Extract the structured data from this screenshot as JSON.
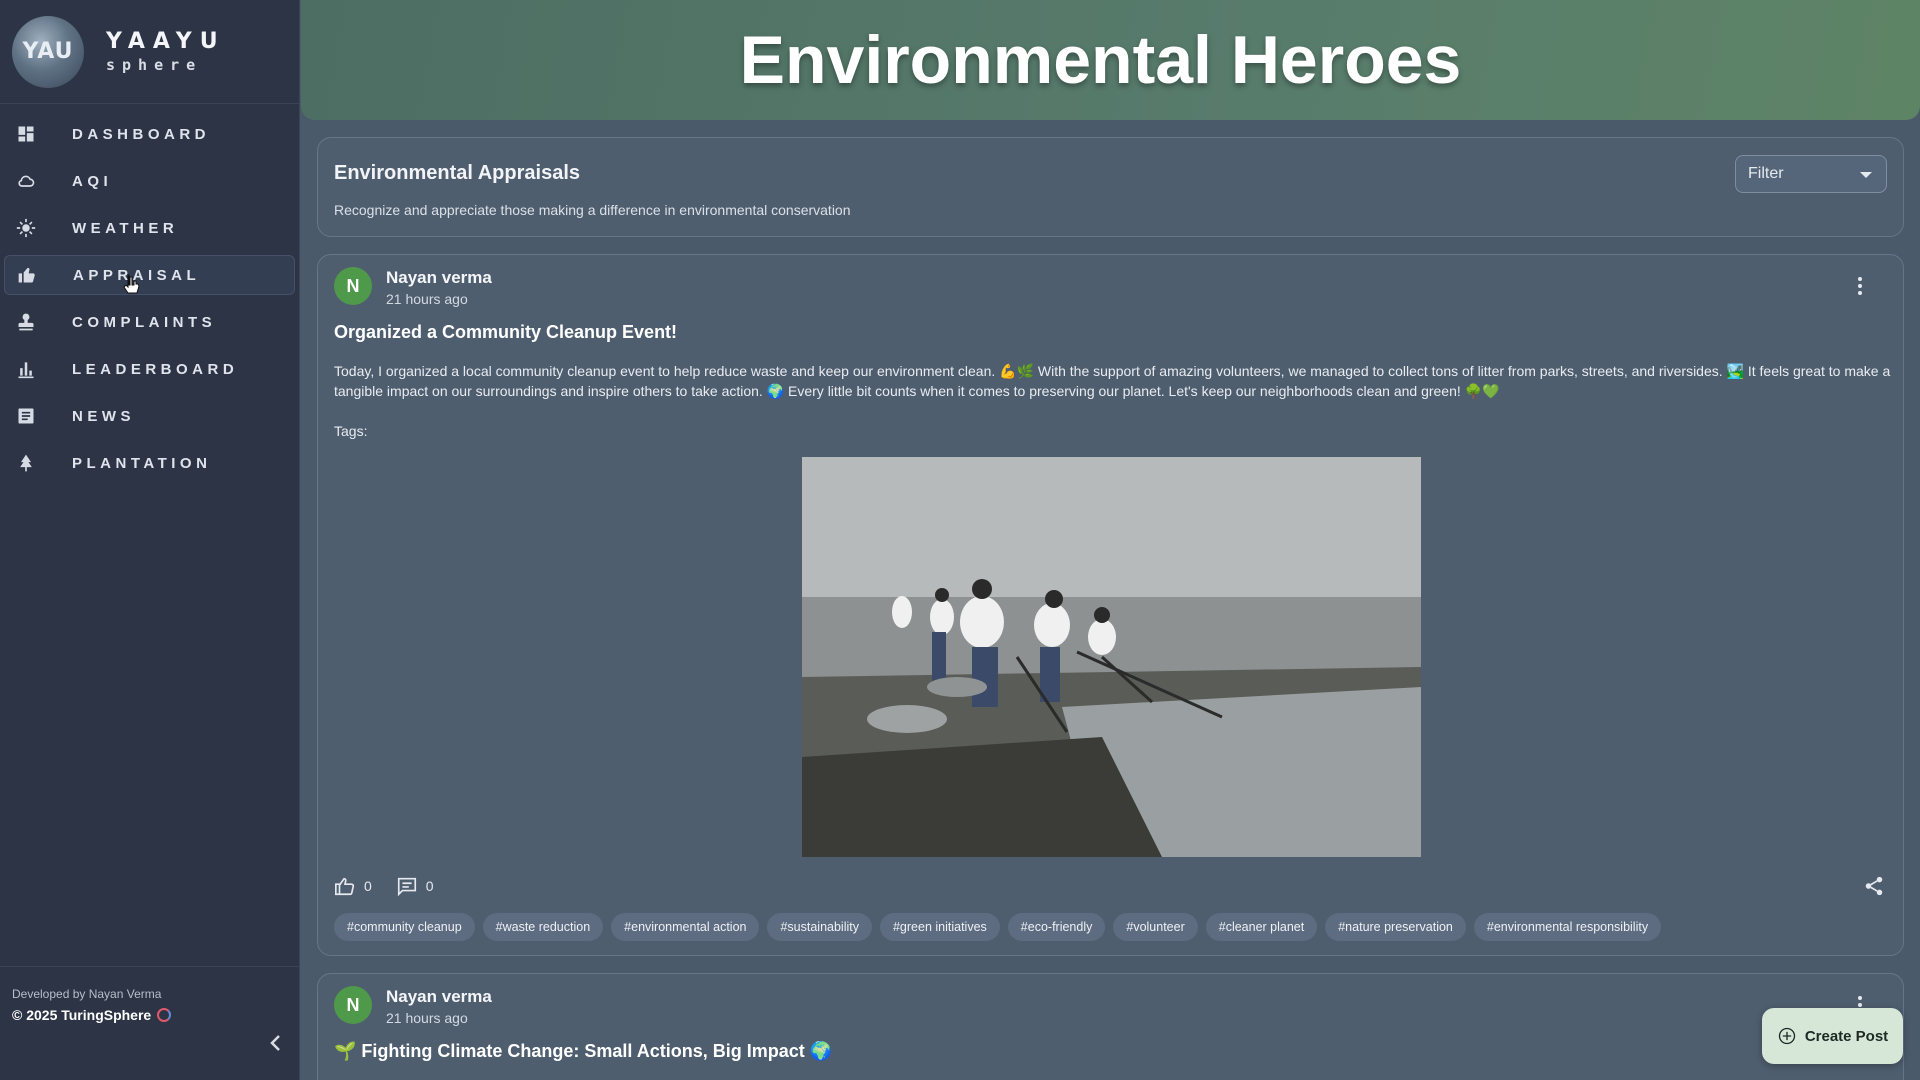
{
  "brand": {
    "logo_text": "YAU",
    "name": "YAAYU",
    "sub": "sphere"
  },
  "nav": {
    "items": [
      {
        "label": "DASHBOARD",
        "icon": "dashboard-icon"
      },
      {
        "label": "AQI",
        "icon": "cloud-icon"
      },
      {
        "label": "WEATHER",
        "icon": "sun-icon"
      },
      {
        "label": "APPRAISAL",
        "icon": "thumbs-up-icon",
        "active": true
      },
      {
        "label": "COMPLAINTS",
        "icon": "stamp-icon"
      },
      {
        "label": "LEADERBOARD",
        "icon": "bar-chart-icon"
      },
      {
        "label": "NEWS",
        "icon": "article-icon"
      },
      {
        "label": "PLANTATION",
        "icon": "tree-icon"
      }
    ]
  },
  "footer": {
    "developed_by": "Developed by Nayan Verma",
    "copyright": "© 2025 TuringSphere"
  },
  "header": {
    "title": "Environmental Heroes"
  },
  "intro": {
    "title": "Environmental Appraisals",
    "subtitle": "Recognize and appreciate those making a difference in environmental conservation",
    "filter_label": "Filter"
  },
  "post1": {
    "avatar": "N",
    "author": "Nayan verma",
    "time": "21 hours ago",
    "title": "Organized a Community Cleanup Event!",
    "body": "Today, I organized a local community cleanup event to help reduce waste and keep our environment clean. 💪🌿 With the support of amazing volunteers, we managed to collect tons of litter from parks, streets, and riversides. 🏞️ It feels great to make a tangible impact on our surroundings and inspire others to take action. 🌍 Every little bit counts when it comes to preserving our planet. Let's keep our neighborhoods clean and green! 🌳💚",
    "tags_label": "Tags:",
    "likes": "0",
    "comments": "0",
    "tags": [
      "#community cleanup",
      "#waste reduction",
      "#environmental action",
      "#sustainability",
      "#green initiatives",
      "#eco-friendly",
      "#volunteer",
      "#cleaner planet",
      "#nature preservation",
      "#environmental responsibility"
    ]
  },
  "post2": {
    "avatar": "N",
    "author": "Nayan verma",
    "time": "21 hours ago",
    "title": "🌱 Fighting Climate Change: Small Actions, Big Impact 🌍"
  },
  "create_post": {
    "label": "Create Post"
  },
  "colors": {
    "sidebar": "#2c3446",
    "content_bg": "#4b5a6b",
    "header_green": "#587c6c",
    "avatar_green": "#4f9a4a",
    "create_post_bg": "#d6e7d8"
  }
}
